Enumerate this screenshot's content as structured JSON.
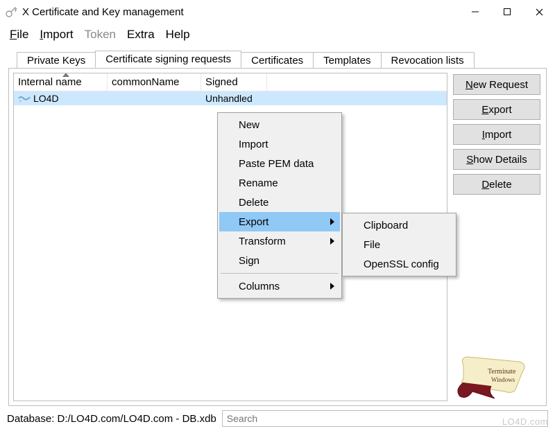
{
  "window": {
    "title": "X Certificate and Key management"
  },
  "menu": {
    "file": "File",
    "import": "Import",
    "token": "Token",
    "extra": "Extra",
    "help": "Help"
  },
  "tabs": {
    "private_keys": "Private Keys",
    "csr": "Certificate signing requests",
    "certs": "Certificates",
    "templates": "Templates",
    "revocation": "Revocation lists"
  },
  "columns": {
    "internal_name": "Internal name",
    "common_name": "commonName",
    "signed": "Signed"
  },
  "rows": [
    {
      "internal_name": "LO4D",
      "common_name": "",
      "signed": "Unhandled"
    }
  ],
  "buttons": {
    "new_request": "ew Request",
    "new_request_accel": "N",
    "export": "xport",
    "export_accel": "E",
    "import": "mport",
    "import_accel": "I",
    "show_details": "how Details",
    "show_details_accel": "S",
    "delete": "elete",
    "delete_accel": "D"
  },
  "context_menu": {
    "new": "New",
    "import": "Import",
    "paste_pem": "Paste PEM data",
    "rename": "Rename",
    "delete": "Delete",
    "export": "Export",
    "transform": "Transform",
    "sign": "Sign",
    "columns": "Columns"
  },
  "export_submenu": {
    "clipboard": "Clipboard",
    "file": "File",
    "openssl": "OpenSSL config"
  },
  "status": {
    "database": "Database: D:/LO4D.com/LO4D.com - DB.xdb",
    "search_placeholder": "Search"
  },
  "watermark": "LO4D.com",
  "scroll_text1": "Terminate",
  "scroll_text2": "Windows"
}
